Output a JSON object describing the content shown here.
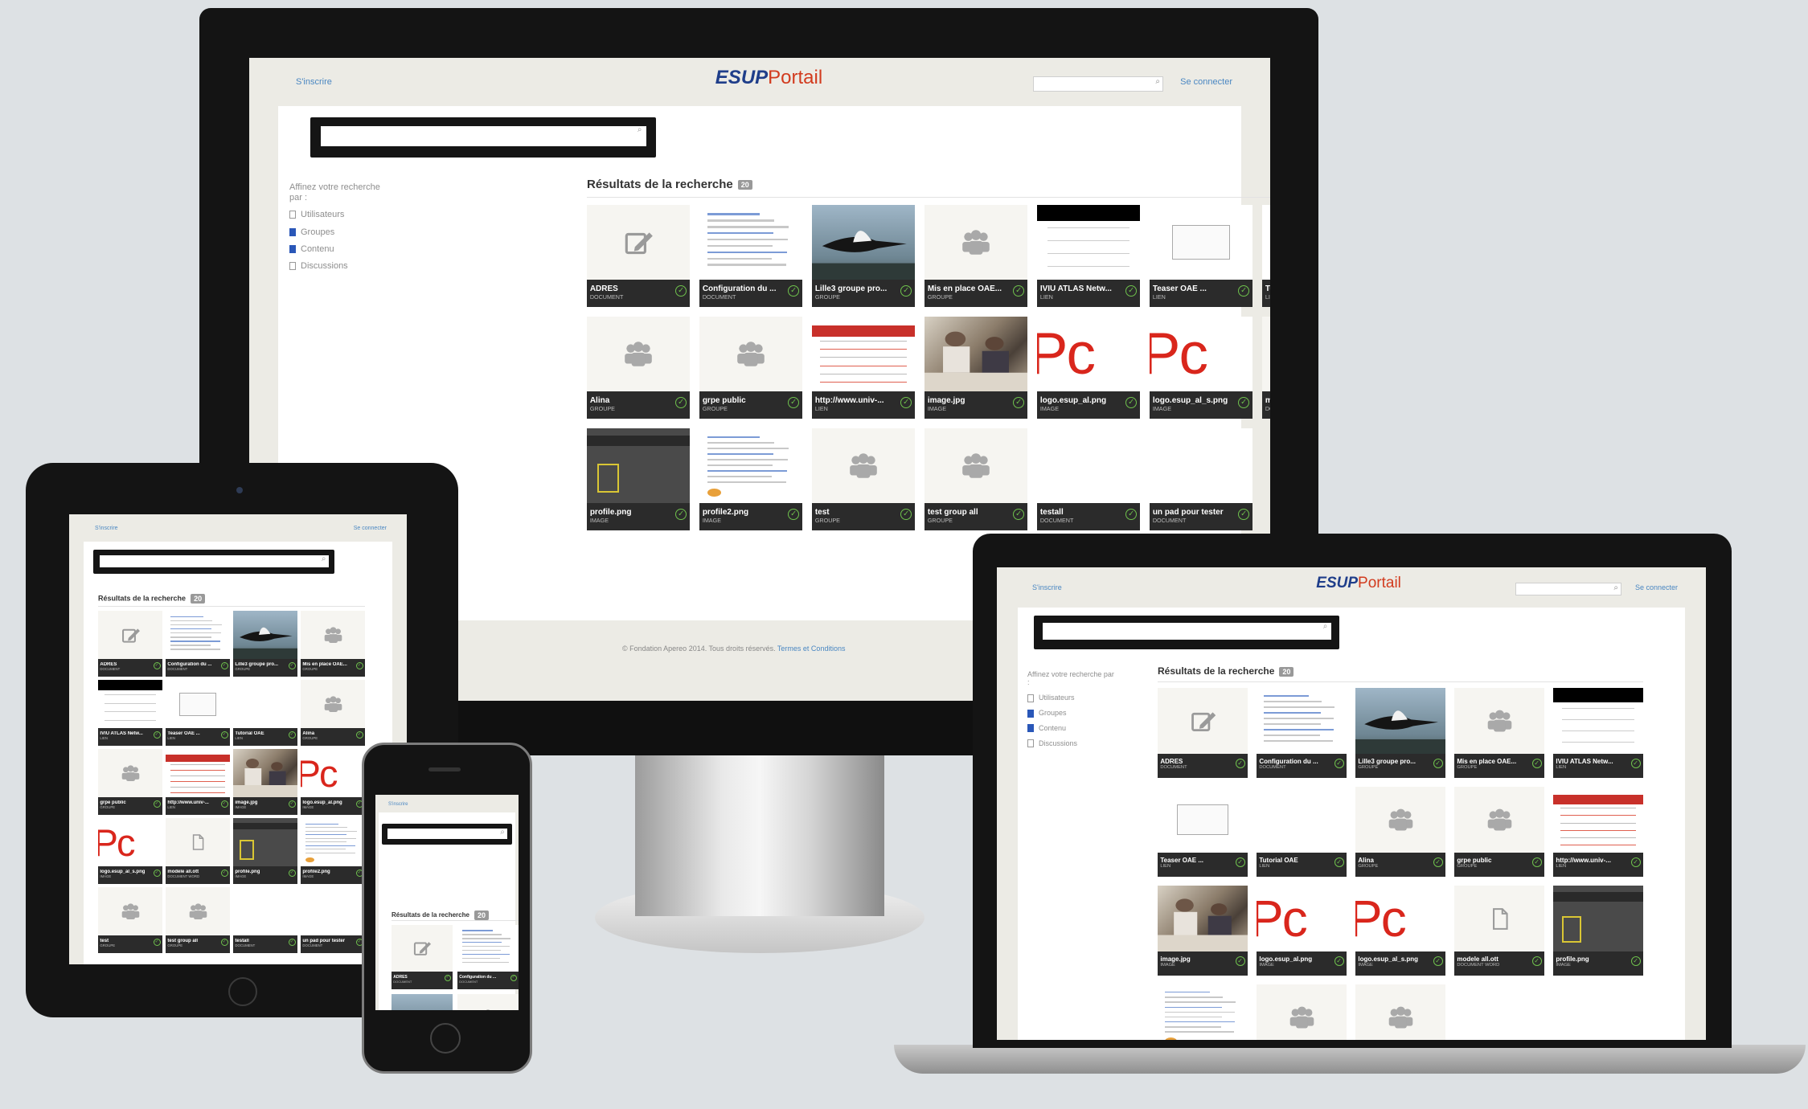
{
  "header": {
    "left_link": "S'inscrire",
    "right_link": "Se connecter",
    "logo": {
      "esup": "ESUP",
      "portail": "Portail"
    }
  },
  "sidebar": {
    "title": "Affinez votre recherche par :",
    "filters": [
      {
        "label": "Utilisateurs",
        "checked": false
      },
      {
        "label": "Groupes",
        "checked": true
      },
      {
        "label": "Contenu",
        "checked": true
      },
      {
        "label": "Discussions",
        "checked": false
      }
    ]
  },
  "results": {
    "title": "Résultats de la recherche",
    "count": "20",
    "items": [
      {
        "title": "ADRES",
        "type": "DOCUMENT",
        "thumb": "edit-icon"
      },
      {
        "title": "Configuration du ...",
        "type": "DOCUMENT",
        "thumb": "document-preview"
      },
      {
        "title": "Lille3 groupe pro...",
        "type": "GROUPE",
        "thumb": "bird-photo"
      },
      {
        "title": "Mis en place OAE...",
        "type": "GROUPE",
        "thumb": "group-icon"
      },
      {
        "title": "IVIU ATLAS Netw...",
        "type": "LIEN",
        "thumb": "web-page"
      },
      {
        "title": "Teaser OAE ...",
        "type": "LIEN",
        "thumb": "form-preview"
      },
      {
        "title": "Tutorial OAE",
        "type": "LIEN",
        "thumb": "blank"
      },
      {
        "title": "Alina",
        "type": "GROUPE",
        "thumb": "group-icon"
      },
      {
        "title": "grpe public",
        "type": "GROUPE",
        "thumb": "group-icon"
      },
      {
        "title": "http://www.univ-...",
        "type": "LIEN",
        "thumb": "website-red"
      },
      {
        "title": "image.jpg",
        "type": "IMAGE",
        "thumb": "office-photo"
      },
      {
        "title": "logo.esup_al.png",
        "type": "IMAGE",
        "thumb": "pc-logo",
        "thumb_text": "Pc"
      },
      {
        "title": "logo.esup_al_s.png",
        "type": "IMAGE",
        "thumb": "pc-logo",
        "thumb_text": "Pc"
      },
      {
        "title": "modele all.ott",
        "type": "DOCUMENT WORD",
        "thumb": "file-icon"
      },
      {
        "title": "profile.png",
        "type": "IMAGE",
        "thumb": "dark-ui"
      },
      {
        "title": "profile2.png",
        "type": "IMAGE",
        "thumb": "profile-page"
      },
      {
        "title": "test",
        "type": "GROUPE",
        "thumb": "group-icon"
      },
      {
        "title": "test group all",
        "type": "GROUPE",
        "thumb": "group-icon"
      },
      {
        "title": "testall",
        "type": "DOCUMENT",
        "thumb": "blank"
      },
      {
        "title": "un pad pour tester",
        "type": "DOCUMENT",
        "thumb": "blank"
      }
    ]
  },
  "footer": {
    "text": "© Fondation Apereo 2014. Tous droits réservés.",
    "link": "Termes et Conditions"
  },
  "colors": {
    "bezel": "#141414",
    "screen_bg": "#ecebe5",
    "caption_bg": "#2b2b2b",
    "link_blue": "#4a87c2",
    "logo_blue": "#1f3e8a",
    "logo_red": "#d23b1e",
    "check_green": "#6fc24d"
  }
}
